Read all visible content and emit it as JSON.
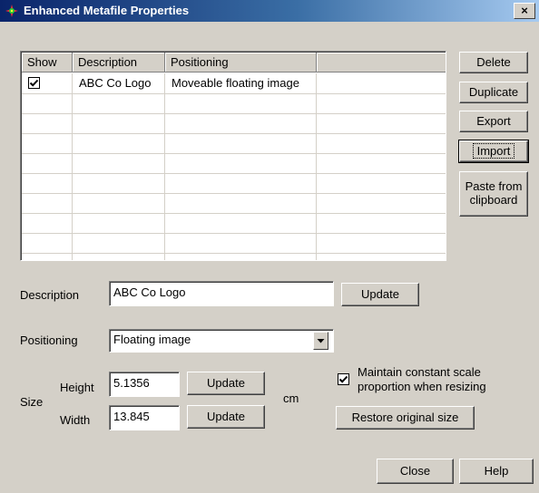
{
  "window": {
    "title": "Enhanced Metafile Properties",
    "close_glyph": "×",
    "icon": "metafile-app-icon"
  },
  "list": {
    "columns": [
      "Show",
      "Description",
      "Positioning",
      ""
    ],
    "rows": [
      {
        "show": true,
        "description": "ABC Co Logo",
        "positioning": "Moveable floating image"
      }
    ]
  },
  "side_buttons": {
    "delete": "Delete",
    "duplicate": "Duplicate",
    "export": "Export",
    "import": "Import",
    "paste_line1": "Paste from",
    "paste_line2": "clipboard"
  },
  "description": {
    "label": "Description",
    "value": "ABC Co Logo",
    "update": "Update"
  },
  "positioning": {
    "label": "Positioning",
    "value": "Floating image"
  },
  "size": {
    "label": "Size",
    "height_label": "Height",
    "height_value": "5.1356",
    "width_label": "Width",
    "width_value": "13.845",
    "update": "Update",
    "unit": "cm"
  },
  "scale": {
    "checked": true,
    "line1": "Maintain constant scale",
    "line2": "proportion when resizing",
    "restore": "Restore original size"
  },
  "footer": {
    "close": "Close",
    "help": "Help"
  }
}
